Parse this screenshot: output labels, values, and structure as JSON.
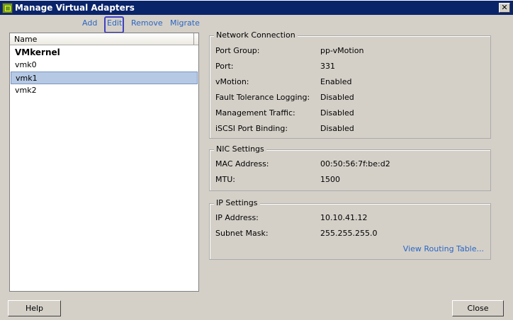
{
  "window": {
    "title": "Manage Virtual Adapters"
  },
  "toolbar": {
    "add": "Add",
    "edit": "Edit",
    "remove": "Remove",
    "migrate": "Migrate"
  },
  "list": {
    "header": "Name",
    "group": "VMkernel",
    "items": [
      "vmk0",
      "vmk1",
      "vmk2"
    ],
    "selected": "vmk1"
  },
  "network_connection": {
    "title": "Network Connection",
    "rows": [
      {
        "label": "Port Group:",
        "value": "pp-vMotion"
      },
      {
        "label": "Port:",
        "value": "331"
      },
      {
        "label": "vMotion:",
        "value": "Enabled"
      },
      {
        "label": "Fault Tolerance Logging:",
        "value": "Disabled"
      },
      {
        "label": "Management Traffic:",
        "value": "Disabled"
      },
      {
        "label": "iSCSI Port Binding:",
        "value": "Disabled"
      }
    ]
  },
  "nic_settings": {
    "title": "NIC Settings",
    "rows": [
      {
        "label": "MAC Address:",
        "value": "00:50:56:7f:be:d2"
      },
      {
        "label": "MTU:",
        "value": "1500"
      }
    ]
  },
  "ip_settings": {
    "title": "IP Settings",
    "rows": [
      {
        "label": "IP Address:",
        "value": "10.10.41.12"
      },
      {
        "label": "Subnet Mask:",
        "value": "255.255.255.0"
      }
    ],
    "routing_link": "View Routing Table..."
  },
  "buttons": {
    "help": "Help",
    "close": "Close"
  }
}
